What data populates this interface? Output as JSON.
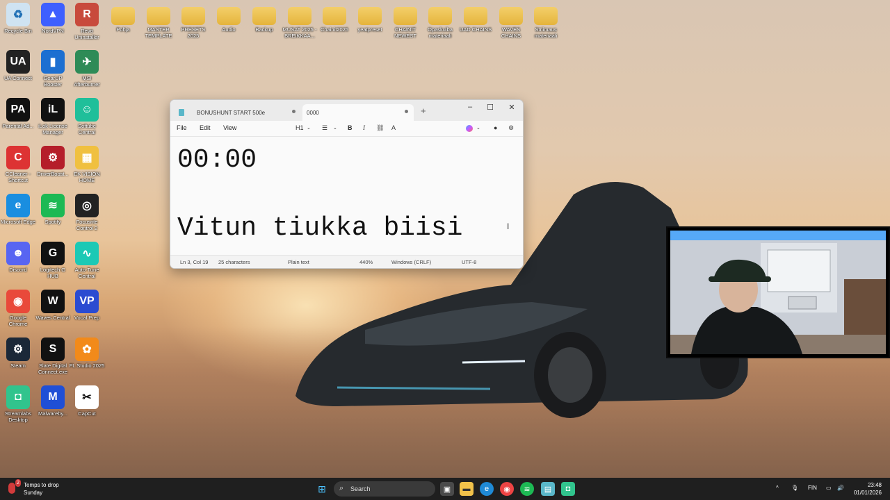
{
  "desktop": {
    "icons": [
      {
        "label": "Recycle Bin",
        "icon": "recycle-bin-icon"
      },
      {
        "label": "NordVPN",
        "icon": "nordvpn-icon"
      },
      {
        "label": "Revo Uninstaller",
        "icon": "revo-icon"
      },
      {
        "label": "Pohja",
        "icon": "folder-icon"
      },
      {
        "label": "MASTER TEMPLATE",
        "icon": "folder-icon"
      },
      {
        "label": "PRESETS 2025",
        "icon": "folder-icon"
      },
      {
        "label": "Audio",
        "icon": "folder-icon"
      },
      {
        "label": "Backup",
        "icon": "folder-icon"
      },
      {
        "label": "MUSAT 2025 - BREIKKAA...",
        "icon": "folder-icon"
      },
      {
        "label": "Chainit2025",
        "icon": "folder-icon"
      },
      {
        "label": "yeatpreset",
        "icon": "folder-icon"
      },
      {
        "label": "CHAINIT NEWEST",
        "icon": "folder-icon"
      },
      {
        "label": "Opaskuiba materiaali",
        "icon": "folder-icon"
      },
      {
        "label": "UAD CHAINS",
        "icon": "folder-icon"
      },
      {
        "label": "WAVES CHAINS",
        "icon": "folder-icon"
      },
      {
        "label": "Striimaus materiaali",
        "icon": "folder-icon"
      },
      {
        "label": "UA Connect",
        "icon": "ua-connect-icon"
      },
      {
        "label": "GearUP Booster",
        "icon": "gearup-icon"
      },
      {
        "label": "MSI Afterburner",
        "icon": "msi-icon"
      },
      {
        "label": "Parental Ad...",
        "icon": "parental-advisory-icon"
      },
      {
        "label": "iLok License Manager",
        "icon": "ilok-icon"
      },
      {
        "label": "Softube Central",
        "icon": "softube-icon"
      },
      {
        "label": "CCleaner - Shortcut",
        "icon": "ccleaner-icon"
      },
      {
        "label": "DriverBoost...",
        "icon": "driverbooster-icon"
      },
      {
        "label": "EK VISION HOME",
        "icon": "ek-vision-icon"
      },
      {
        "label": "Microsoft Edge",
        "icon": "edge-icon"
      },
      {
        "label": "Spotify",
        "icon": "spotify-icon"
      },
      {
        "label": "Focusrite Control 2",
        "icon": "focusrite-icon"
      },
      {
        "label": "Discord",
        "icon": "discord-icon"
      },
      {
        "label": "Logitech G HUB",
        "icon": "logitech-icon"
      },
      {
        "label": "Auto-Tune Central",
        "icon": "autotune-icon"
      },
      {
        "label": "Google Chrome",
        "icon": "chrome-icon"
      },
      {
        "label": "Waves Central",
        "icon": "waves-icon"
      },
      {
        "label": "Vocal Prep",
        "icon": "vocal-prep-icon"
      },
      {
        "label": "Steam",
        "icon": "steam-icon"
      },
      {
        "label": "Slate Digital Connect.exe",
        "icon": "slate-digital-icon"
      },
      {
        "label": "FL Studio 2025",
        "icon": "fl-studio-icon"
      },
      {
        "label": "Streamlabs Desktop",
        "icon": "streamlabs-icon"
      },
      {
        "label": "Malwareby...",
        "icon": "malwarebytes-icon"
      },
      {
        "label": "CapCut",
        "icon": "capcut-icon"
      }
    ]
  },
  "notepad": {
    "tabs": [
      {
        "label": "BONUSHUNT START 500e"
      },
      {
        "label": "0000"
      }
    ],
    "new_tab": "+",
    "window_controls": {
      "minimize": "–",
      "maximize": "☐",
      "close": "✕"
    },
    "menu": {
      "file": "File",
      "edit": "Edit",
      "view": "View"
    },
    "toolbar": {
      "heading": "H1",
      "list": "☰",
      "bold": "B",
      "italic": "I",
      "link": "⛓",
      "format": "A"
    },
    "content": {
      "line1": "00:00",
      "line3": "Vitun tiukka biisi"
    },
    "status": {
      "position": "Ln 3, Col 19",
      "chars": "25 characters",
      "format": "Plain text",
      "zoom": "440%",
      "line_ending": "Windows (CRLF)",
      "encoding": "UTF-8"
    }
  },
  "taskbar": {
    "weather_title": "Temps to drop",
    "weather_sub": "Sunday",
    "weather_badge": "2",
    "search_placeholder": "Search",
    "language": "FIN",
    "time": "23:48",
    "date": "01/01/2026"
  }
}
